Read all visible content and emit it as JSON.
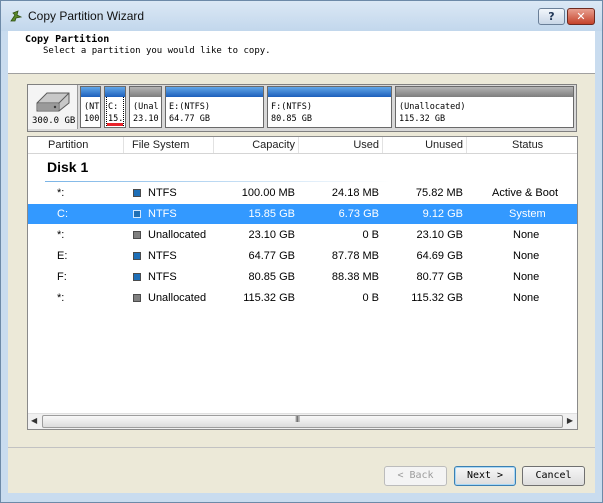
{
  "window": {
    "title": "Copy Partition Wizard",
    "help_label": "?",
    "close_label": "✕"
  },
  "header": {
    "title": "Copy Partition",
    "subtitle": "Select a partition you would like to copy."
  },
  "disk_map": {
    "disk_size": "300.0 GB",
    "blocks": [
      {
        "line1": "(NT",
        "line2": "100",
        "type": "ntfs"
      },
      {
        "line1": "C:",
        "line2": "15.",
        "type": "ntfs",
        "selected": true
      },
      {
        "line1": "(Unal",
        "line2": "23.10",
        "type": "unal"
      },
      {
        "line1": "E:(NTFS)",
        "line2": "64.77 GB",
        "type": "ntfs"
      },
      {
        "line1": "F:(NTFS)",
        "line2": "80.85 GB",
        "type": "ntfs"
      },
      {
        "line1": "(Unallocated)",
        "line2": "115.32 GB",
        "type": "unal"
      }
    ]
  },
  "table": {
    "columns": [
      "Partition",
      "File System",
      "Capacity",
      "Used",
      "Unused",
      "Status"
    ],
    "disk_label": "Disk 1",
    "rows": [
      {
        "partition": "*:",
        "fs": "NTFS",
        "fs_type": "ntfs",
        "capacity": "100.00 MB",
        "used": "24.18 MB",
        "unused": "75.82 MB",
        "status": "Active & Boot"
      },
      {
        "partition": "C:",
        "fs": "NTFS",
        "fs_type": "ntfs",
        "capacity": "15.85 GB",
        "used": "6.73 GB",
        "unused": "9.12 GB",
        "status": "System",
        "selected": true
      },
      {
        "partition": "*:",
        "fs": "Unallocated",
        "fs_type": "unal",
        "capacity": "23.10 GB",
        "used": "0 B",
        "unused": "23.10 GB",
        "status": "None"
      },
      {
        "partition": "E:",
        "fs": "NTFS",
        "fs_type": "ntfs",
        "capacity": "64.77 GB",
        "used": "87.78 MB",
        "unused": "64.69 GB",
        "status": "None"
      },
      {
        "partition": "F:",
        "fs": "NTFS",
        "fs_type": "ntfs",
        "capacity": "80.85 GB",
        "used": "88.38 MB",
        "unused": "80.77 GB",
        "status": "None"
      },
      {
        "partition": "*:",
        "fs": "Unallocated",
        "fs_type": "unal",
        "capacity": "115.32 GB",
        "used": "0 B",
        "unused": "115.32 GB",
        "status": "None"
      }
    ]
  },
  "scrollbar": {
    "left_arrow": "◀",
    "right_arrow": "▶",
    "grip": "III"
  },
  "buttons": {
    "back": "< Back",
    "next": "Next >",
    "cancel": "Cancel"
  },
  "colors": {
    "ntfs": "#1e6fb7",
    "unallocated": "#808080",
    "selection": "#3399ff",
    "selected_marker": "#e8232a"
  }
}
